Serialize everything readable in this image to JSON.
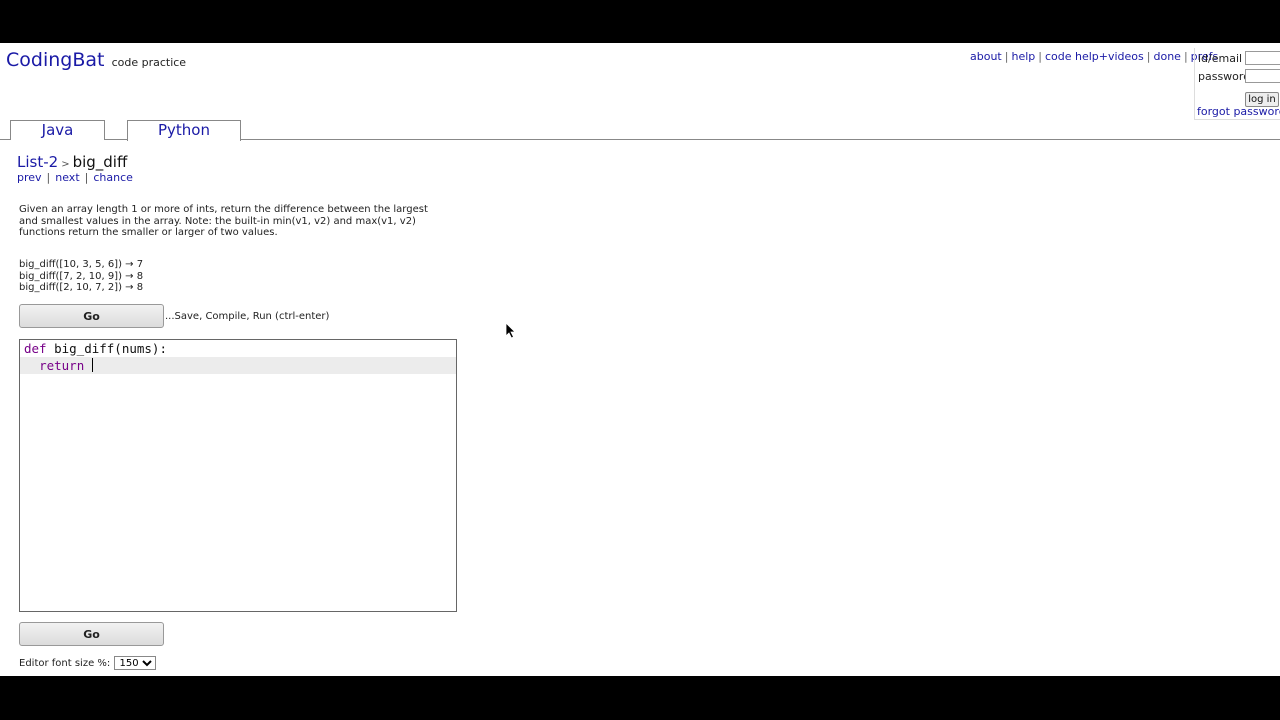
{
  "header": {
    "brand": "CodingBat",
    "tagline": "code practice",
    "links": [
      {
        "label": "about"
      },
      {
        "label": "help"
      },
      {
        "label": "code help+videos"
      },
      {
        "label": "done"
      },
      {
        "label": "prefs"
      }
    ],
    "separator": "|"
  },
  "login": {
    "id_label": "id/email",
    "password_label": "password",
    "id_value": "",
    "password_value": "",
    "button_label": "log in",
    "forgot_label": "forgot password",
    "forgot_sep": "|"
  },
  "tabs": [
    {
      "label": "Java",
      "active": false
    },
    {
      "label": "Python",
      "active": true
    }
  ],
  "problem": {
    "section": "List-2",
    "crumb_sep": ">",
    "name": "big_diff",
    "nav": [
      {
        "label": "prev"
      },
      {
        "label": "next"
      },
      {
        "label": "chance"
      }
    ],
    "nav_sep": "|",
    "description": "Given an array length 1 or more of ints, return the difference between the largest and smallest values in the array. Note: the built-in min(v1, v2) and max(v1, v2) functions return the smaller or larger of two values.",
    "examples": [
      "big_diff([10, 3, 5, 6]) → 7",
      "big_diff([7, 2, 10, 9]) → 8",
      "big_diff([2, 10, 7, 2]) → 8"
    ]
  },
  "actions": {
    "go_label": "Go",
    "go_hint": "...Save, Compile, Run (ctrl-enter)"
  },
  "editor": {
    "line1_kw": "def",
    "line1_rest": " big_diff(nums):",
    "line2_indent": "  ",
    "line2_kw": "return",
    "line2_rest": " "
  },
  "editor_font": {
    "label": "Editor font size %:",
    "selected": "150"
  },
  "colors": {
    "link": "#1a1aa6",
    "keyword": "#770088",
    "active_line": "#ececec"
  }
}
